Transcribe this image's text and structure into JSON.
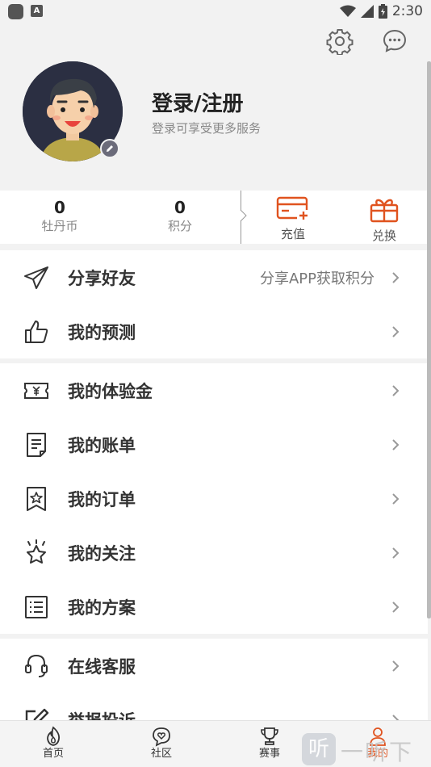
{
  "status_bar": {
    "time": "2:30",
    "app_badge": "A"
  },
  "header": {
    "settings_icon": "gear-icon",
    "message_icon": "chat-bubble-icon"
  },
  "profile": {
    "title": "登录/注册",
    "subtitle": "登录可享受更多服务"
  },
  "stats": [
    {
      "value": "0",
      "label": "牡丹币"
    },
    {
      "value": "0",
      "label": "积分"
    }
  ],
  "actions": [
    {
      "label": "充值",
      "icon": "recharge-card-icon"
    },
    {
      "label": "兑换",
      "icon": "gift-icon"
    }
  ],
  "menu_groups": [
    [
      {
        "label": "分享好友",
        "hint": "分享APP获取积分",
        "icon": "paper-plane-icon"
      },
      {
        "label": "我的预测",
        "hint": "",
        "icon": "thumbs-up-icon"
      }
    ],
    [
      {
        "label": "我的体验金",
        "hint": "",
        "icon": "coupon-icon"
      },
      {
        "label": "我的账单",
        "hint": "",
        "icon": "bill-icon"
      },
      {
        "label": "我的订单",
        "hint": "",
        "icon": "order-icon"
      },
      {
        "label": "我的关注",
        "hint": "",
        "icon": "star-icon"
      },
      {
        "label": "我的方案",
        "hint": "",
        "icon": "list-icon"
      }
    ],
    [
      {
        "label": "在线客服",
        "hint": "",
        "icon": "headset-icon"
      },
      {
        "label": "举报投诉",
        "hint": "",
        "icon": "edit-icon"
      }
    ]
  ],
  "tabs": [
    {
      "label": "首页",
      "icon": "fire-icon",
      "active": false
    },
    {
      "label": "社区",
      "icon": "community-icon",
      "active": false
    },
    {
      "label": "赛事",
      "icon": "trophy-icon",
      "active": false
    },
    {
      "label": "我的",
      "icon": "person-icon",
      "active": true
    }
  ],
  "watermark": {
    "badge": "听",
    "text": "一听下载"
  },
  "colors": {
    "accent": "#e0531f",
    "background": "#f2f2f2"
  }
}
